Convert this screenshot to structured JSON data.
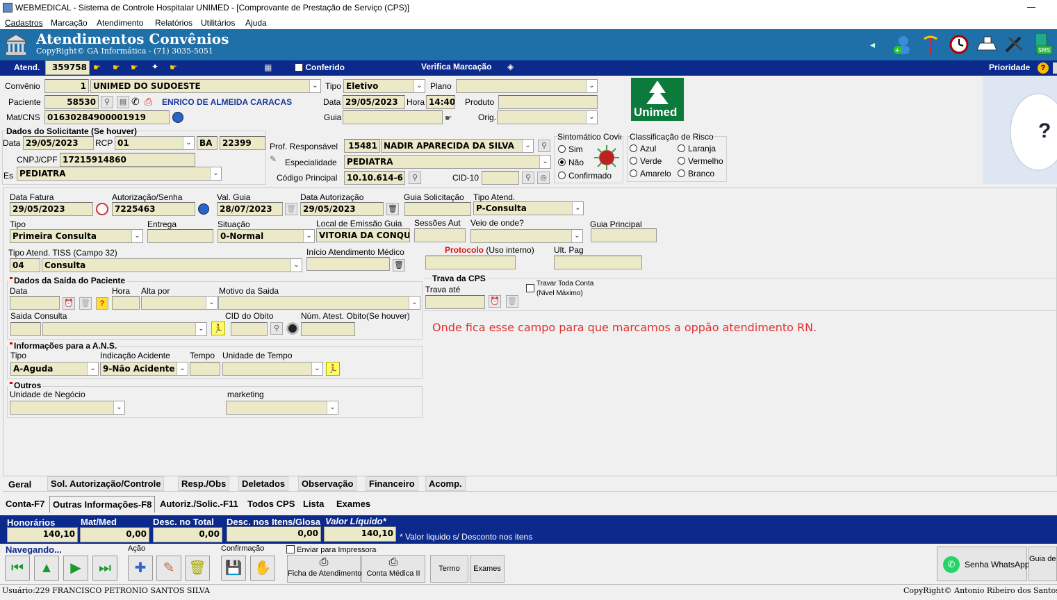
{
  "window": {
    "title": "WEBMEDICAL - Sistema de Controle Hospitalar UNIMED - [Comprovante de Prestação de Serviço  (CPS)]"
  },
  "menu": [
    "Cadastros",
    "Marcação",
    "Atendimento",
    "Relatórios",
    "Utilitários",
    "Ajuda"
  ],
  "header": {
    "title": "Atendimentos Convênios",
    "subtitle": "CopyRight© GA Informática - (71) 3035-5051"
  },
  "topbar": {
    "atend_label": "Atend.",
    "atend_value": "359758",
    "conferido": "Conferido",
    "verifica": "Verifica Marcação",
    "prioridade": "Prioridade"
  },
  "convenio": {
    "label": "Convênio",
    "code": "1",
    "name": "UNIMED DO SUDOESTE",
    "tipo_label": "Tipo",
    "tipo": "Eletivo",
    "plano_label": "Plano",
    "plano": ""
  },
  "paciente": {
    "label": "Paciente",
    "code": "58530",
    "name": "ENRICO DE ALMEIDA CARACAS",
    "data_label": "Data",
    "data": "29/05/2023",
    "hora_label": "Hora",
    "hora": "14:40",
    "produto_label": "Produto",
    "produto": ""
  },
  "mat": {
    "label": "Mat/CNS",
    "value": "01630284900001919",
    "guia_label": "Guia",
    "orig_label": "Orig."
  },
  "solicitante": {
    "title": "Dados do Solicitante (Se houver)",
    "data_label": "Data",
    "data": "29/05/2023",
    "rcp_label": "RCP",
    "rcp": "01",
    "uf": "BA",
    "crm": "22399",
    "cnpj_label": "CNPJ/CPF",
    "cnpj": "17215914860",
    "esp_label": "Es",
    "esp": "PEDIATRA"
  },
  "prof": {
    "label": "Prof. Responsável",
    "code": "15481",
    "name": "NADIR APARECIDA DA SILVA",
    "esp_label": "Especialidade",
    "esp": "PEDIATRA",
    "cod_label": "Código Principal",
    "cod": "10.10.614-6",
    "cid_label": "CID-10"
  },
  "sintomatico": {
    "title": "Sintomático Covid",
    "options": [
      "Sim",
      "Não",
      "Confirmado"
    ],
    "selected": "Não"
  },
  "risco": {
    "title": "Classificação de Risco",
    "options": [
      "Azul",
      "Laranja",
      "Verde",
      "Vermelho",
      "Amarelo",
      "Branco"
    ]
  },
  "logo": {
    "text": "Unimed"
  },
  "fatura": {
    "data_fatura_label": "Data Fatura",
    "data_fatura": "29/05/2023",
    "autorizacao_label": "Autorização/Senha",
    "autorizacao": "7225463",
    "val_guia_label": "Val. Guia",
    "val_guia": "28/07/2023",
    "data_aut_label": "Data Autorização",
    "data_aut": "29/05/2023",
    "guia_sol_label": "Guia Solicitação",
    "tipo_atend_label": "Tipo Atend.",
    "tipo_atend": "P-Consulta"
  },
  "row2": {
    "tipo_label": "Tipo",
    "tipo": "Primeira Consulta",
    "entrega_label": "Entrega",
    "situacao_label": "Situação",
    "situacao": "0-Normal",
    "local_label": "Local de Emissão Guia",
    "local": "VITORIA DA CONQUI",
    "sessoes_label": "Sessões Aut",
    "veio_label": "Veio de onde?",
    "guia_principal_label": "Guia Principal"
  },
  "row3": {
    "tiss_label": "Tipo Atend. TISS (Campo 32)",
    "tiss_code": "04",
    "tiss": "Consulta",
    "inicio_label": "Início Atendimento Médico",
    "protocolo_label": "Protocolo",
    "protocolo_note": "(Uso interno)",
    "ult_label": "Ult. Pag"
  },
  "saida": {
    "title": "Dados da Saida do Paciente",
    "data_label": "Data",
    "hora_label": "Hora",
    "alta_label": "Alta por",
    "motivo_label": "Motivo da Saida",
    "consulta_label": "Saida Consulta",
    "cid_label": "CID do Obito",
    "num_label": "Núm. Atest. Obito(Se houver)"
  },
  "trava": {
    "title": "Trava da CPS",
    "ate_label": "Trava até",
    "toda_label": "Travar Toda Conta",
    "toda_note": "(Nivel Máximo)"
  },
  "annotation": "Onde fica esse campo para que marcamos a oppão atendimento RN.",
  "ans": {
    "title": "Informações para a A.N.S.",
    "tipo_label": "Tipo",
    "tipo": "A-Aguda",
    "acidente_label": "Indicação Acidente",
    "acidente": "9-Não Acidente",
    "tempo_label": "Tempo",
    "unidade_label": "Unidade de Tempo"
  },
  "outros": {
    "title": "Outros",
    "negocio_label": "Unidade de Negócio",
    "marketing_label": "marketing"
  },
  "tabs1": [
    "Geral",
    "Sol. Autorização/Controle",
    "Resp./Obs",
    "Deletados",
    "Observação",
    "Financeiro",
    "Acomp."
  ],
  "tabs2": [
    "Conta-F7",
    "Outras Informações-F8",
    "Autoriz./Solic.-F11",
    "Todos CPS",
    "Lista",
    "Exames"
  ],
  "totais": {
    "hon_label": "Honorários",
    "hon": "140,10",
    "mat_label": "Mat/Med",
    "mat": "0,00",
    "desc_label": "Desc. no Total",
    "desc": "0,00",
    "itens_label": "Desc. nos Itens/Glosa",
    "itens": "0,00",
    "liq_label": "Valor Líquido*",
    "liq": "140,10",
    "note": "* Valor liquido s/ Desconto nos itens"
  },
  "bottom": {
    "nav_label": "Navegando...",
    "acao_label": "Ação",
    "conf_label": "Confirmação",
    "imp_label": "Enviar para Impressora",
    "ficha": "Ficha de Atendimento",
    "conta": "Conta Médica II",
    "termo": "Termo",
    "exames": "Exames",
    "whats": "Senha WhatsApp",
    "guia": "Guia de Autoriza"
  },
  "status": {
    "user": "Usuário:229 FRANCISCO PETRONIO SANTOS SILVA",
    "copy": "CopyRight© Antonio Ribeiro dos Santos Jr. -"
  }
}
